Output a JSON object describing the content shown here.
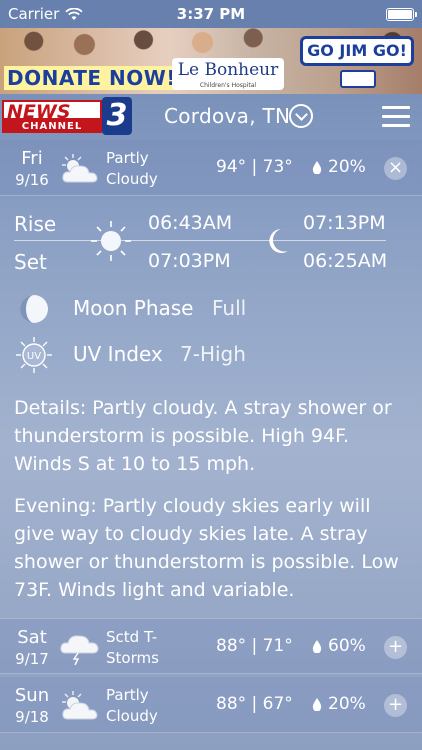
{
  "status_bar": {
    "carrier": "Carrier",
    "time": "3:37 PM"
  },
  "ad": {
    "donate": "DONATE NOW!",
    "logo": "Le Bonheur",
    "logo_sub": "Children's Hospital",
    "sign": "GO JIM GO!"
  },
  "header": {
    "logo_news": "NEWS",
    "logo_channel": "CHANNEL",
    "logo_number": "3",
    "location": "Cordova, TN"
  },
  "today": {
    "day": "Fri",
    "date": "9/16",
    "condition_line1": "Partly",
    "condition_line2": "Cloudy",
    "temps": "94° | 73°",
    "precip": "20%",
    "close_symbol": "×",
    "icon": "partly-cloudy-icon"
  },
  "sun_moon": {
    "rise_label": "Rise",
    "set_label": "Set",
    "sunrise": "06:43AM",
    "sunset": "07:03PM",
    "moonrise": "07:13PM",
    "moonset": "06:25AM"
  },
  "moon_phase": {
    "label": "Moon Phase",
    "value": "Full"
  },
  "uv_index": {
    "label": "UV Index",
    "value": "7-High",
    "icon_text": "UV"
  },
  "details": {
    "day": "Details: Partly cloudy. A stray shower or thunderstorm is possible. High 94F. Winds S at 10 to 15 mph.",
    "evening": "Evening: Partly cloudy skies early will give way to cloudy skies late. A stray shower or thunderstorm is possible. Low 73F. Winds light and variable."
  },
  "forecast": [
    {
      "day": "Sat",
      "date": "9/17",
      "condition_line1": "Sctd T-",
      "condition_line2": "Storms",
      "temps": "88° | 71°",
      "precip": "60%",
      "expand_symbol": "+",
      "icon": "thunderstorm-icon"
    },
    {
      "day": "Sun",
      "date": "9/18",
      "condition_line1": "Partly",
      "condition_line2": "Cloudy",
      "temps": "88° | 67°",
      "precip": "20%",
      "expand_symbol": "+",
      "icon": "partly-cloudy-icon"
    }
  ],
  "colors": {
    "brand_red": "#c3161c",
    "brand_blue": "#1b3b8c",
    "sky": "#8fa3c6"
  }
}
